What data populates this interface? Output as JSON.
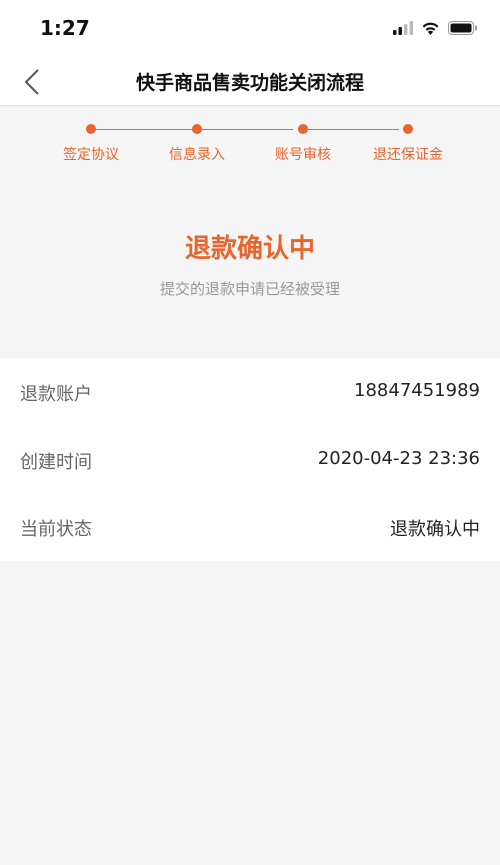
{
  "status_bar": {
    "time": "1:27",
    "icons": [
      "cellular-signal-icon",
      "wifi-icon",
      "battery-icon"
    ]
  },
  "nav": {
    "title": "快手商品售卖功能关闭流程",
    "back_icon": "chevron-left-icon"
  },
  "steps": [
    {
      "label": "签定协议"
    },
    {
      "label": "信息录入"
    },
    {
      "label": "账号审核"
    },
    {
      "label": "退还保证金"
    }
  ],
  "hero": {
    "title": "退款确认中",
    "subtitle": "提交的退款申请已经被受理"
  },
  "info": [
    {
      "label": "退款账户",
      "value": "18847451989"
    },
    {
      "label": "创建时间",
      "value": "2020-04-23 23:36"
    },
    {
      "label": "当前状态",
      "value": "退款确认中"
    }
  ],
  "colors": {
    "accent": "#e8652d",
    "background": "#f5f5f5",
    "panel": "#ffffff"
  }
}
